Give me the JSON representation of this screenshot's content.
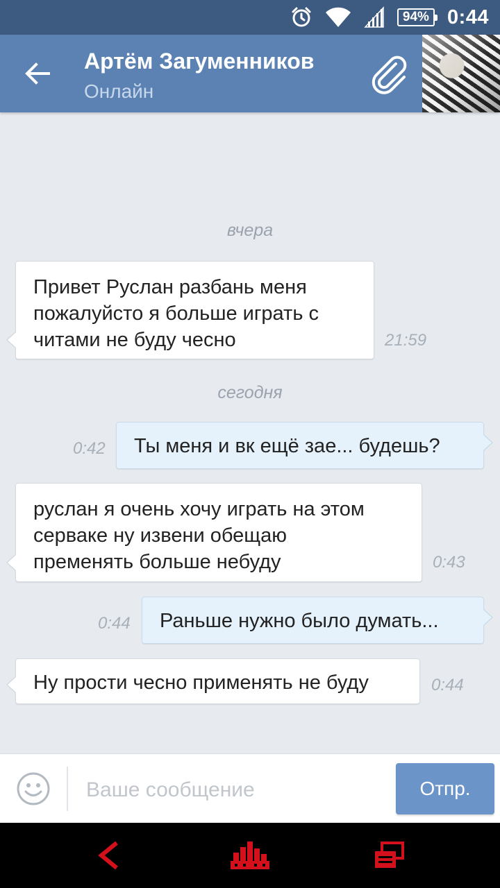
{
  "status_bar": {
    "battery": "94%",
    "time": "0:44",
    "icons": [
      "alarm-icon",
      "wifi-icon",
      "signal-icon",
      "battery-icon"
    ]
  },
  "header": {
    "contact_name": "Артём Загуменников",
    "contact_status": "Онлайн",
    "icons": [
      "back-arrow-icon",
      "paperclip-icon"
    ]
  },
  "chat": {
    "date_yesterday": "вчера",
    "date_today": "сегодня",
    "messages": [
      {
        "direction": "incoming",
        "lines": [
          "Привет Руслан разбань меня",
          "пожалуйсто я больше играть с",
          "читами не буду чесно"
        ],
        "time": "21:59"
      },
      {
        "direction": "outgoing",
        "lines": [
          "Ты меня и вк ещё зае... будешь?"
        ],
        "time": "0:42"
      },
      {
        "direction": "incoming",
        "lines": [
          "руслан я очень хочу играть на этом",
          "серваке ну извени обещаю",
          "пременять больше небуду"
        ],
        "time": "0:43"
      },
      {
        "direction": "outgoing",
        "lines": [
          "Раньше нужно было думать..."
        ],
        "time": "0:44"
      },
      {
        "direction": "incoming",
        "lines": [
          "Ну прости чесно применять не буду"
        ],
        "time": "0:44"
      }
    ]
  },
  "input_bar": {
    "placeholder": "Ваше сообщение",
    "value": "",
    "send_label": "Отпр.",
    "icons": [
      "emoji-icon"
    ]
  },
  "nav_bar": {
    "icons": [
      "back-nav-icon",
      "home-nav-icon",
      "recents-nav-icon"
    ],
    "accent_color": "#d4101c"
  },
  "colors": {
    "status_bar": "#3d5a80",
    "header": "#5b82b3",
    "chat_background": "#e7ebf0",
    "incoming_bubble": "#ffffff",
    "outgoing_bubble": "#e5f2fc",
    "send_button": "#6b95c8"
  }
}
